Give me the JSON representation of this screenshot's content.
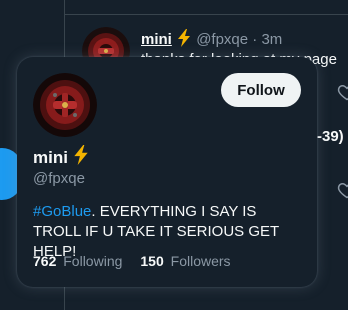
{
  "colors": {
    "background": "#15202b",
    "accent": "#1d9bf0",
    "text_primary": "#f7f9f9",
    "text_secondary": "#8b98a5",
    "bolt": "#f4b400",
    "follow_bg": "#eff3f4"
  },
  "background_tweet": {
    "name": "mini",
    "handle": "@fpxqe",
    "separator": "·",
    "time": "3m",
    "text": "thanks for looking at my page",
    "snippet": "-39)"
  },
  "hover_card": {
    "follow_label": "Follow",
    "display_name": "mini",
    "name_icon": "lightning-bolt-icon",
    "handle": "@fpxqe",
    "bio_hashtag": "#GoBlue",
    "bio_text": ". EVERYTHING I SAY IS TROLL IF U TAKE IT SERIOUS GET HELP!",
    "following_count": "762",
    "following_label": "Following",
    "followers_count": "150",
    "followers_label": "Followers"
  }
}
